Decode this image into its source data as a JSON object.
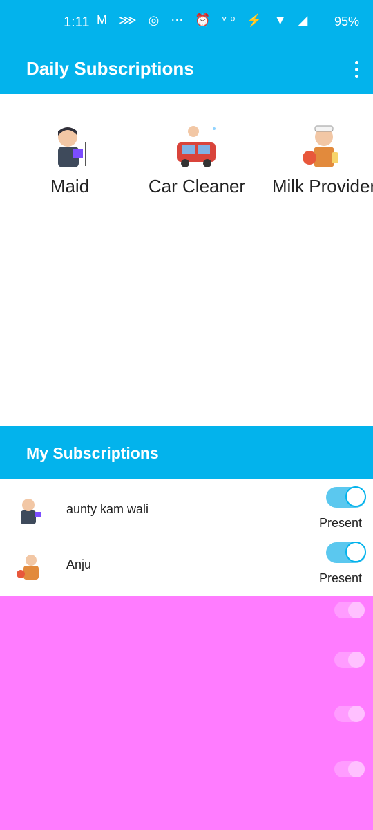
{
  "status_bar": {
    "time": "1:11",
    "icons": "M ⋙ ◎ ⋯ ⏰ ᵛᵒ ⚡ ▼ ◢",
    "battery": "95%"
  },
  "app_bar": {
    "title": "Daily Subscriptions"
  },
  "services": [
    {
      "label": "Maid"
    },
    {
      "label": "Car Cleaner"
    },
    {
      "label": "Milk Provider"
    }
  ],
  "section": {
    "title": "My Subscriptions"
  },
  "subscriptions": [
    {
      "name": "aunty kam wali",
      "status": "Present"
    },
    {
      "name": "Anju",
      "status": "Present"
    }
  ],
  "colors": {
    "primary": "#03b3ec",
    "overlay": "#ff7cff"
  }
}
